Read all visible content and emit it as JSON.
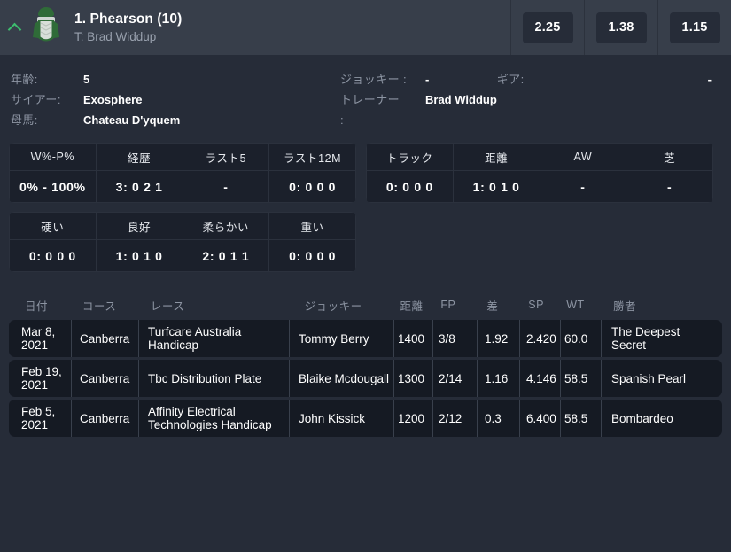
{
  "header": {
    "expand_icon": "chevron-up-icon",
    "silk_icon": "jockey-silk-icon",
    "runner_title": "1. Phearson (10)",
    "trainer_line": "T: Brad Widdup",
    "odds": [
      "2.25",
      "1.38",
      "1.15"
    ],
    "accent_color": "#3dbd6e",
    "bg_color": "#373e4a"
  },
  "bio": {
    "age_label": "年齢:",
    "age_value": "5",
    "sire_label": "サイアー:",
    "sire_value": "Exosphere",
    "dam_label": "母馬:",
    "dam_value": "Chateau D'yquem",
    "jockey_label": "ジョッキー :",
    "jockey_value": "-",
    "trainer_label": "トレーナー",
    "trainer_label_cont": ":",
    "trainer_value": "Brad Widdup",
    "gear_label": "ギア:",
    "gear_value": "-"
  },
  "stats": {
    "row1_left": {
      "headers": [
        "W%-P%",
        "経歴",
        "ラスト5",
        "ラスト12M"
      ],
      "values": [
        "0% - 100%",
        "3: 0 2 1",
        "-",
        "0: 0 0 0"
      ]
    },
    "row1_right": {
      "headers": [
        "トラック",
        "距離",
        "AW",
        "芝"
      ],
      "values": [
        "0: 0 0 0",
        "1: 0 1 0",
        "-",
        "-"
      ]
    },
    "row2_left": {
      "headers": [
        "硬い",
        "良好",
        "柔らかい",
        "重い"
      ],
      "values": [
        "0: 0 0 0",
        "1: 0 1 0",
        "2: 0 1 1",
        "0: 0 0 0"
      ]
    }
  },
  "form": {
    "columns": [
      "日付",
      "コース",
      "レース",
      "ジョッキー",
      "距離",
      "FP",
      "差",
      "SP",
      "WT",
      "勝者"
    ],
    "rows": [
      {
        "date": "Mar 8, 2021",
        "course": "Canberra",
        "race": "Turfcare Australia Handicap",
        "jockey": "Tommy Berry",
        "distance": "1400",
        "fp": "3/8",
        "margin": "1.92",
        "sp": "2.420",
        "wt": "60.0",
        "winner": "The Deepest Secret"
      },
      {
        "date": "Feb 19, 2021",
        "course": "Canberra",
        "race": "Tbc Distribution Plate",
        "jockey": "Blaike Mcdougall",
        "distance": "1300",
        "fp": "2/14",
        "margin": "1.16",
        "sp": "4.146",
        "wt": "58.5",
        "winner": "Spanish Pearl"
      },
      {
        "date": "Feb 5, 2021",
        "course": "Canberra",
        "race": "Affinity Electrical Technologies Handicap",
        "jockey": "John Kissick",
        "distance": "1200",
        "fp": "2/12",
        "margin": "0.3",
        "sp": "6.400",
        "wt": "58.5",
        "winner": "Bombardeo"
      }
    ]
  }
}
